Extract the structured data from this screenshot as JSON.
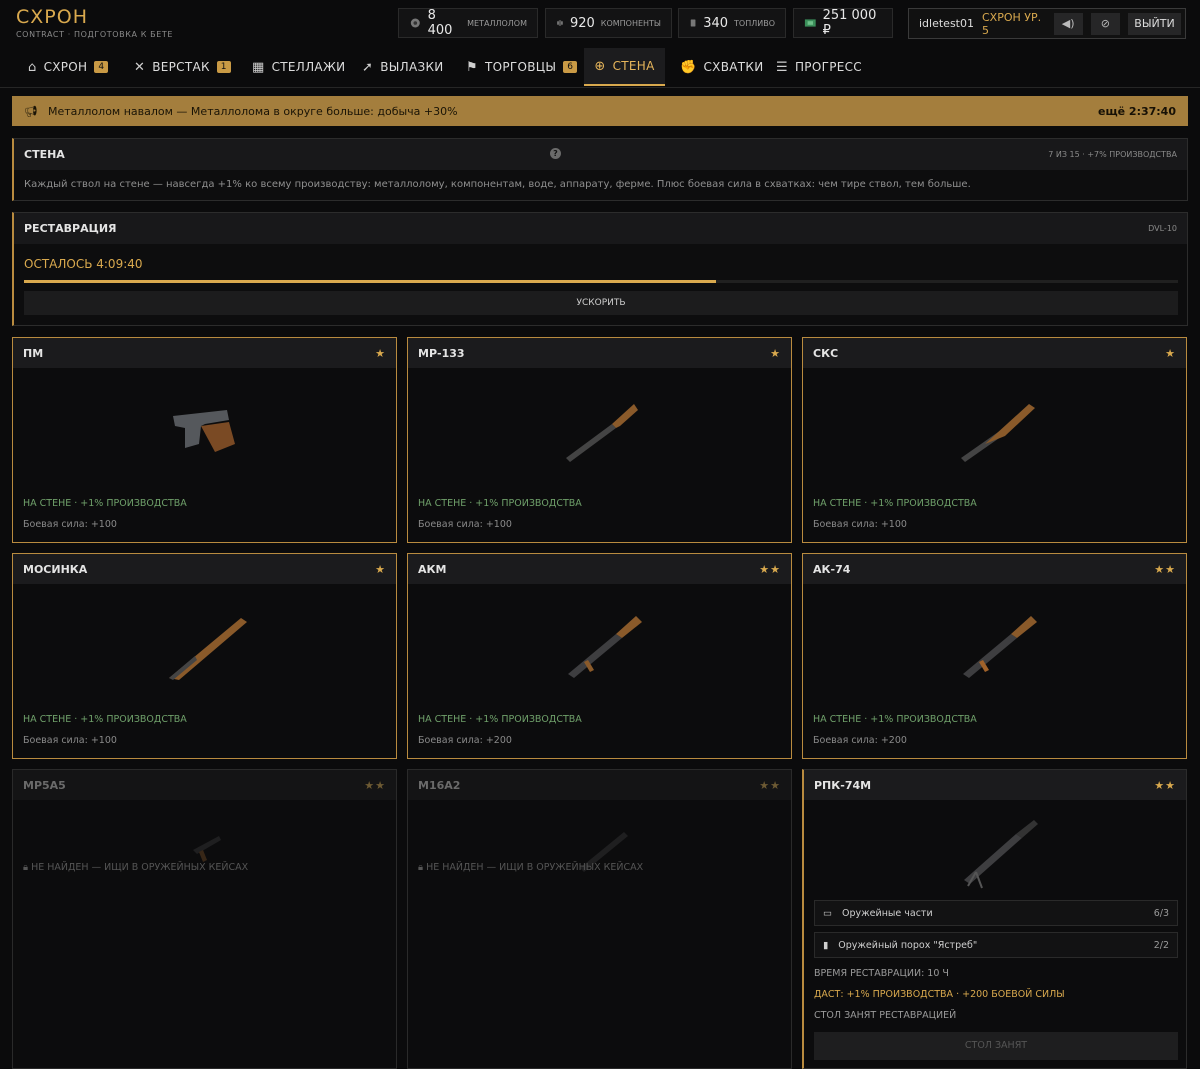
{
  "app": {
    "title": "СХРОН",
    "subtitle": "CONTRACT · ПОДГОТОВКА К БЕТЕ"
  },
  "resources": [
    {
      "icon": "scrap-icon",
      "value": "8 400",
      "label": "МЕТАЛЛОЛОМ"
    },
    {
      "icon": "components-icon",
      "value": "920",
      "label": "КОМПОНЕНТЫ"
    },
    {
      "icon": "fuel-icon",
      "value": "340",
      "label": "ТОПЛИВО"
    },
    {
      "icon": "money-icon",
      "value": "251 000 ₽",
      "label": ""
    }
  ],
  "user": {
    "name": "idletest01",
    "level": "СХРОН УР. 5",
    "logout": "ВЫЙТИ"
  },
  "tabs": [
    {
      "label": "СХРОН",
      "glyph": "⌂",
      "badge": "4"
    },
    {
      "label": "ВЕРСТАК",
      "glyph": "✕",
      "badge": "1"
    },
    {
      "label": "СТЕЛЛАЖИ",
      "glyph": "▦",
      "badge": ""
    },
    {
      "label": "ВЫЛАЗКИ",
      "glyph": "➚",
      "badge": ""
    },
    {
      "label": "ТОРГОВЦЫ",
      "glyph": "⚑",
      "badge": "6"
    },
    {
      "label": "СТЕНА",
      "glyph": "⊕",
      "badge": ""
    },
    {
      "label": "СХВАТКИ",
      "glyph": "✊",
      "badge": ""
    },
    {
      "label": "ПРОГРЕСС",
      "glyph": "☰",
      "badge": ""
    }
  ],
  "event": {
    "text": "Металлолом навалом — Металлолома в округе больше: добыча +30%",
    "timer": "ещё 2:37:40"
  },
  "wall": {
    "title": "СТЕНА",
    "count": "7 ИЗ 15 · +7% ПРОИЗВОДСТВА",
    "desc": "Каждый ствол на стене — навсегда +1% ко всему производству: металлолому, компонентам, воде, аппарату, ферме. Плюс боевая сила в схватках: чем тире ствол, тем больше."
  },
  "restoration": {
    "title": "РЕСТАВРАЦИЯ",
    "code": "DVL-10",
    "remaining": "ОСТАЛОСЬ 4:09:40",
    "progress": 0.6,
    "speed_up": "УСКОРИТЬ"
  },
  "cards": [
    {
      "name": "ПМ",
      "stars": "★",
      "status": "НА СТЕНЕ · +1% ПРОИЗВОДСТВА",
      "power": "Боевая сила: +100"
    },
    {
      "name": "МР-133",
      "stars": "★",
      "status": "НА СТЕНЕ · +1% ПРОИЗВОДСТВА",
      "power": "Боевая сила: +100"
    },
    {
      "name": "СКС",
      "stars": "★",
      "status": "НА СТЕНЕ · +1% ПРОИЗВОДСТВА",
      "power": "Боевая сила: +100"
    },
    {
      "name": "МОСИНКА",
      "stars": "★",
      "status": "НА СТЕНЕ · +1% ПРОИЗВОДСТВА",
      "power": "Боевая сила: +100"
    },
    {
      "name": "АКМ",
      "stars": "★★",
      "status": "НА СТЕНЕ · +1% ПРОИЗВОДСТВА",
      "power": "Боевая сила: +200"
    },
    {
      "name": "АК-74",
      "stars": "★★",
      "status": "НА СТЕНЕ · +1% ПРОИЗВОДСТВА",
      "power": "Боевая сила: +200"
    },
    {
      "name": "MP5A5",
      "stars": "★★",
      "status": "НЕ НАЙДЕН — ИЩИ В ОРУЖЕЙНЫХ КЕЙСАХ"
    },
    {
      "name": "M16A2",
      "stars": "★★",
      "status": "НЕ НАЙДЕН — ИЩИ В ОРУЖЕЙНЫХ КЕЙСАХ"
    },
    {
      "name": "РПК-74М",
      "stars": "★★",
      "reqs": [
        {
          "label": "Оружейные части",
          "count": "6/3"
        },
        {
          "label": "Оружейный порох \"Ястреб\"",
          "count": "2/2"
        }
      ],
      "time": "ВРЕМЯ РЕСТАВРАЦИИ: 10 Ч",
      "gives": "ДАСТ: +1% ПРОИЗВОДСТВА · +200 БОЕВОЙ СИЛЫ",
      "busy_note": "СТОЛ ЗАНЯТ РЕСТАВРАЦИЕЙ",
      "busy_btn": "СТОЛ ЗАНЯТ"
    }
  ]
}
